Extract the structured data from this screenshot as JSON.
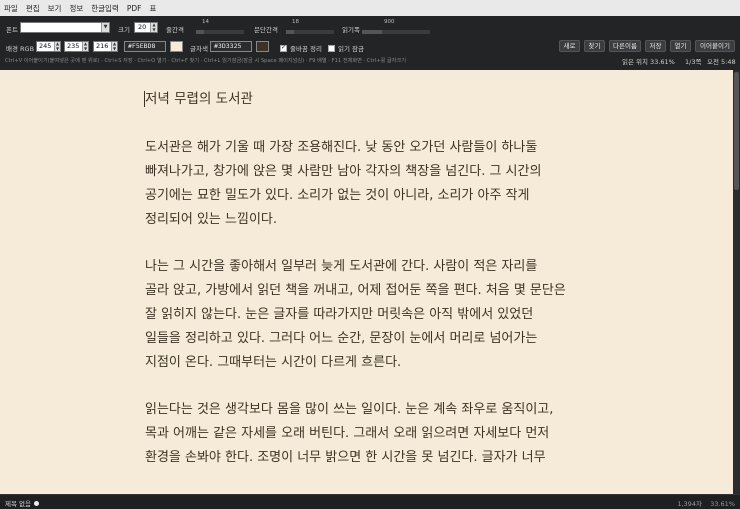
{
  "menu": [
    "파일",
    "편집",
    "보기",
    "정보",
    "한글입력",
    "PDF",
    "표"
  ],
  "toolbar": {
    "font_label": "폰트",
    "size_label": "크기",
    "size_value": "20",
    "line_spacing_label": "줄간격",
    "line_spacing_value": "14",
    "para_spacing_label": "문단간격",
    "para_spacing_value": "18",
    "read_width_label": "읽기폭",
    "read_width_value": "900",
    "bg_rgb_label": "배경 RGB",
    "bg_r": "245",
    "bg_g": "235",
    "bg_b": "216",
    "bg_hex": "#F5EBD8",
    "text_color_label": "글자색",
    "text_hex": "#3D3325",
    "auto_save_label": "줄바꿈 정리",
    "auto_save_checked": true,
    "read_lock_label": "읽기 잠금",
    "read_lock_checked": false,
    "buttons": [
      "새로",
      "찾기",
      "다른이름",
      "저장",
      "열기",
      "이어붙이기"
    ],
    "hint": "Ctrl+V 이어붙이기(붙여넣은 곳에 맨 위로) · Ctrl+S 저장 · Ctrl+O 열기 · Ctrl+F 찾기 · Ctrl+L 읽기잠금(잠금 시 Space 페이지넘김) · F9 배열 · F11 전체화면 · Ctrl+휠 글자크기",
    "read_position": "읽은 위치 33.61%",
    "page_indicator": "1/3쪽",
    "clock": "오전 5:48"
  },
  "colors": {
    "background": "#f5ebd8",
    "text": "#3d3325",
    "bg_swatch": "#f5ebd8",
    "text_swatch": "#3d3325"
  },
  "document": {
    "title": "저녁 무렵의 도서관",
    "paragraphs": [
      [
        "도서관은 해가 기울 때 가장 조용해진다. 낮 동안 오가던 사람들이 하나둘",
        "빠져나가고, 창가에 앉은 몇 사람만 남아 각자의 책장을 넘긴다. 그 시간의",
        "공기에는 묘한 밀도가 있다. 소리가 없는 것이 아니라, 소리가 아주 작게",
        "정리되어 있는 느낌이다."
      ],
      [
        "나는 그 시간을 좋아해서 일부러 늦게 도서관에 간다. 사람이 적은 자리를",
        "골라 앉고, 가방에서 읽던 책을 꺼내고, 어제 접어둔 쪽을 편다. 처음 몇 문단은",
        "잘 읽히지 않는다. 눈은 글자를 따라가지만 머릿속은 아직 밖에서 있었던",
        "일들을 정리하고 있다. 그러다 어느 순간, 문장이 눈에서 머리로 넘어가는",
        "지점이 온다. 그때부터는 시간이 다르게 흐른다."
      ],
      [
        "읽는다는 것은 생각보다 몸을 많이 쓰는 일이다. 눈은 계속 좌우로 움직이고,",
        "목과 어깨는 같은 자세를 오래 버틴다. 그래서 오래 읽으려면 자세보다 먼저",
        "환경을 손봐야 한다. 조명이 너무 밝으면 한 시간을 못 넘긴다. 글자가 너무"
      ]
    ]
  },
  "status": {
    "doc_name": "제목 없음",
    "char_count": "1,394자",
    "percent": "33.61%"
  }
}
